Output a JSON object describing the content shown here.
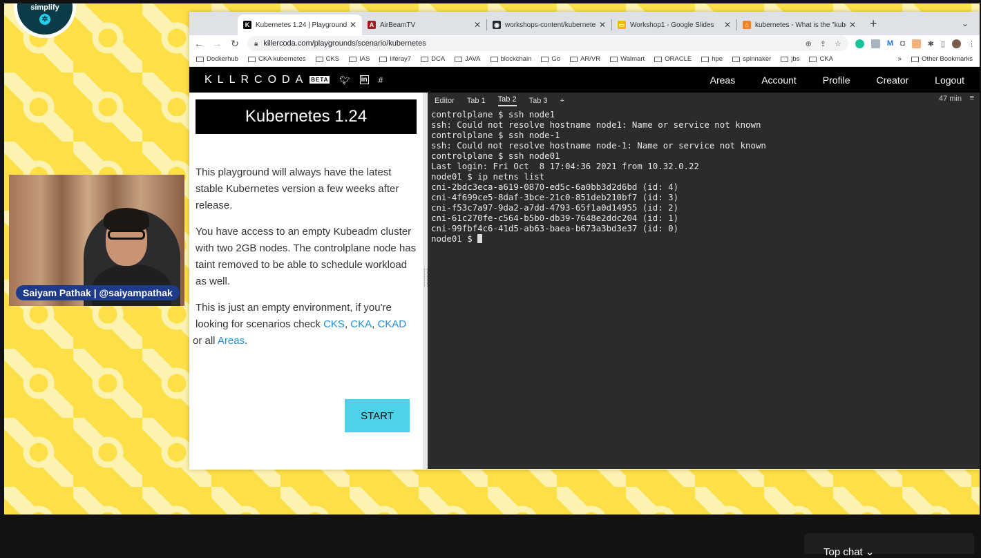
{
  "stream_logo": {
    "text": "simplify",
    "mark": "✲"
  },
  "presenter": {
    "name_tag": "Saiyam Pathak | @saiyampathak"
  },
  "browser": {
    "tabs": [
      {
        "title": "Kubernetes 1.24 | Playgrounds",
        "favicon": "K",
        "favicon_color": "#000000",
        "active": true
      },
      {
        "title": "AirBeamTV",
        "favicon": "A",
        "favicon_color": "#9b1c1c",
        "active": false
      },
      {
        "title": "workshops-content/kubernetes",
        "favicon": "◉",
        "favicon_color": "#24292f",
        "active": false
      },
      {
        "title": "Workshop1 - Google Slides",
        "favicon": "▭",
        "favicon_color": "#f4b400",
        "active": false
      },
      {
        "title": "kubernetes - What is the \"kube",
        "favicon": "⌂",
        "favicon_color": "#f48024",
        "active": false
      }
    ],
    "new_tab": "+",
    "tab_menu": "⌄",
    "url": "killercoda.com/playgrounds/scenario/kubernetes",
    "bookmarks": [
      "Dockerhub",
      "CKA kubernetes",
      "CKS",
      "IAS",
      "liferay7",
      "DCA",
      "JAVA",
      "blockchain",
      "Go",
      "AR/VR",
      "Walmart",
      "ORACLE",
      "hpe",
      "spinnaker",
      "jbs",
      "CKA"
    ],
    "bookmarks_more": "»",
    "other_bookmarks": "Other Bookmarks"
  },
  "site": {
    "logo": "KLLRCODA",
    "beta": "BETA",
    "nav": [
      "Areas",
      "Account",
      "Profile",
      "Creator",
      "Logout"
    ]
  },
  "scenario": {
    "title": "Kubernetes 1.24",
    "p1": "This playground will always have the latest stable Kubernetes version a few weeks after release.",
    "p2": "You have access to an empty Kubeadm cluster with two 2GB nodes. The controlplane node has taint removed to be able to schedule workload as well.",
    "p3_prefix": "This is just an empty environment, if you're looking for scenarios check ",
    "links": [
      "CKS",
      "CKA",
      "CKAD"
    ],
    "sep": ", ",
    "p3_mid": " or all ",
    "areas_link": "Areas",
    "p3_suffix": ".",
    "start": "START"
  },
  "terminal": {
    "tabs": [
      "Editor",
      "Tab 1",
      "Tab 2",
      "Tab 3",
      "+"
    ],
    "active_tab": 2,
    "timer": "47 min",
    "menu": "≡",
    "lines": [
      "controlplane $ ssh node1",
      "ssh: Could not resolve hostname node1: Name or service not known",
      "controlplane $ ssh node-1",
      "ssh: Could not resolve hostname node-1: Name or service not known",
      "controlplane $ ssh node01",
      "Last login: Fri Oct  8 17:04:36 2021 from 10.32.0.22",
      "node01 $ ip netns list",
      "cni-2bdc3eca-a619-0870-ed5c-6a0bb3d2d6bd (id: 4)",
      "cni-4f699ce5-8daf-3bce-21c0-851deb210bf7 (id: 3)",
      "cni-f53c7a97-9da2-a7dd-4793-65f1a0d14955 (id: 2)",
      "cni-61c270fe-c564-b5b0-db39-7648e2ddc204 (id: 1)",
      "cni-99fbf4c6-41d5-ab63-baea-b673a3bd3e37 (id: 0)"
    ],
    "prompt": "node01 $ "
  },
  "chat": {
    "label": "Top chat ⌄"
  }
}
